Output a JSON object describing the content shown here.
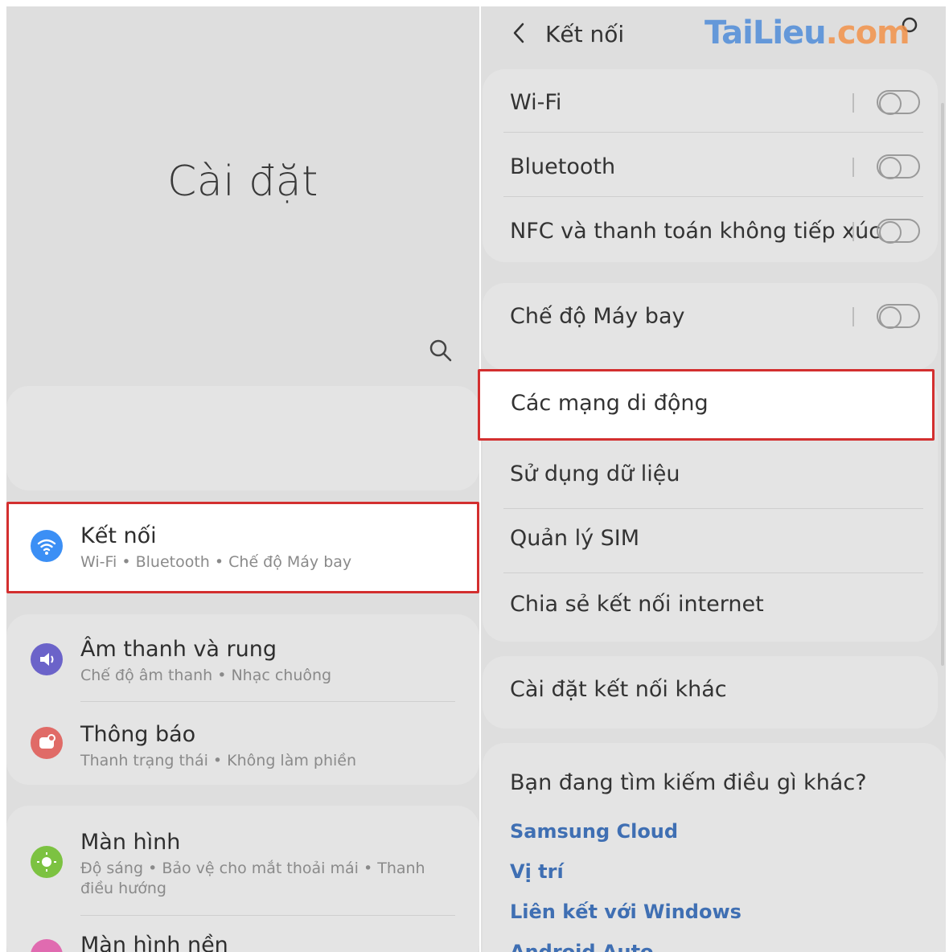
{
  "left": {
    "title": "Cài đặt",
    "items": [
      {
        "title": "Kết nối",
        "sub": "Wi-Fi  •  Bluetooth  •  Chế độ Máy bay",
        "icon": "wifi-icon",
        "color": "#3b8ff5"
      },
      {
        "title": "Âm thanh và rung",
        "sub": "Chế độ âm thanh  •  Nhạc chuông",
        "icon": "speaker-icon",
        "color": "#6b63c9"
      },
      {
        "title": "Thông báo",
        "sub": "Thanh trạng thái  •  Không làm phiền",
        "icon": "notification-icon",
        "color": "#e06b67"
      },
      {
        "title": "Màn hình",
        "sub": "Độ sáng  •  Bảo vệ cho mắt thoải mái  •  Thanh điều hướng",
        "icon": "brightness-icon",
        "color": "#7cc241"
      },
      {
        "title": "Màn hình nền",
        "icon": "wallpaper-icon",
        "color": "#e06bb0"
      }
    ]
  },
  "right": {
    "header_title": "Kết nối",
    "watermark": {
      "part1": "Tai",
      "part2": "Lieu",
      "part3": ".c",
      "part4": "o",
      "part5": "m"
    },
    "toggles": [
      {
        "label": "Wi-Fi",
        "on": false
      },
      {
        "label": "Bluetooth",
        "on": false
      },
      {
        "label": "NFC và thanh toán không tiếp xúc",
        "on": false
      },
      {
        "label": "Chế độ Máy bay",
        "on": false
      }
    ],
    "items": [
      {
        "label": "Các mạng di động"
      },
      {
        "label": "Sử dụng dữ liệu"
      },
      {
        "label": "Quản lý SIM"
      },
      {
        "label": "Chia sẻ kết nối internet"
      },
      {
        "label": "Cài đặt kết nối khác"
      }
    ],
    "suggest": {
      "title": "Bạn đang tìm kiếm điều gì khác?",
      "links": [
        "Samsung Cloud",
        "Vị trí",
        "Liên kết với Windows",
        "Android Auto"
      ]
    }
  },
  "colors": {
    "highlight": "#d32f2f",
    "link": "#3f6fb3"
  }
}
